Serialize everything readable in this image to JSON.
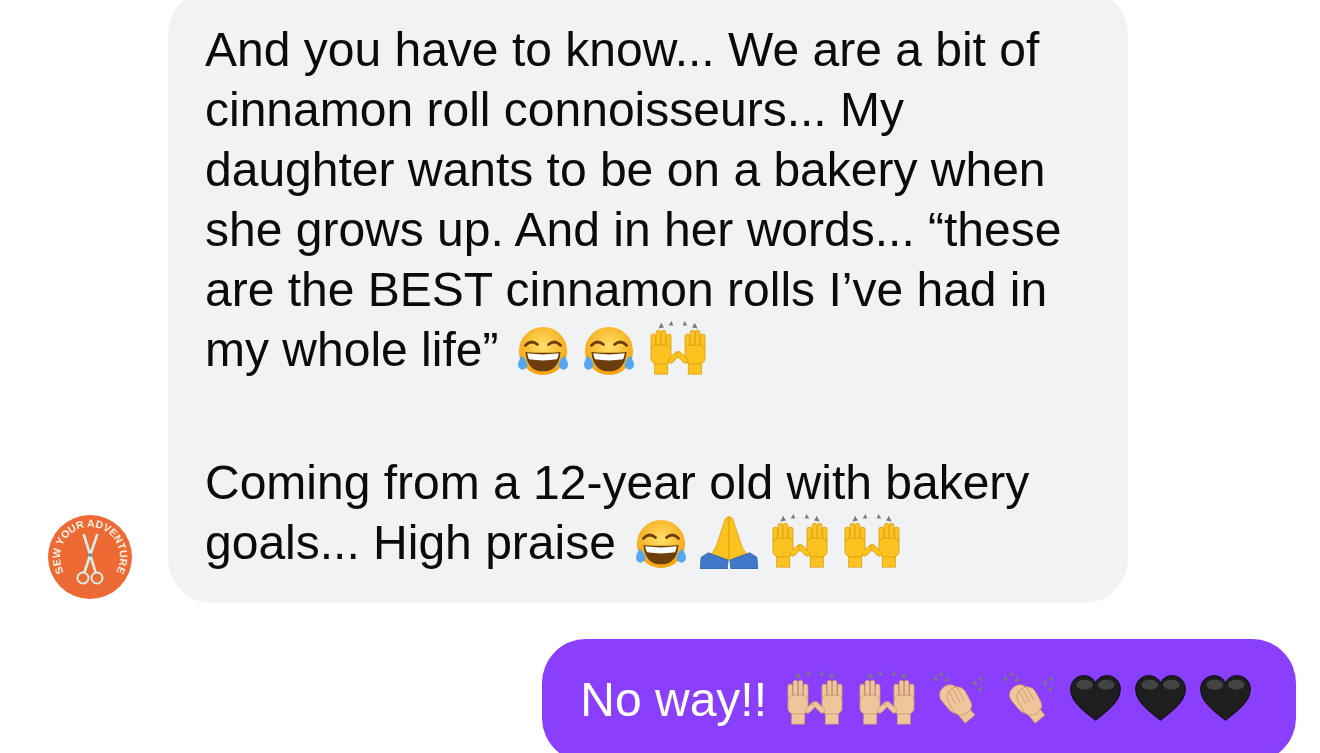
{
  "conversation": {
    "messages": [
      {
        "kind": "received",
        "avatar": {
          "text": "SEW YOUR ADVENTURE"
        },
        "paragraphs": [
          {
            "lines": [
              "And you have to know... We are a bit of",
              "cinnamon roll connoisseurs... My",
              "daughter wants to be on a bakery when",
              "she grows up. And in her words... “these",
              "are the BEST cinnamon rolls I’ve had in",
              "my whole life”"
            ],
            "emojis": [
              {
                "kind": "laugh"
              },
              {
                "kind": "laugh"
              },
              {
                "kind": "raise",
                "light_skin": false
              }
            ]
          },
          {
            "lines": [
              "Coming from a 12-year old with bakery",
              "goals... High praise"
            ],
            "emojis": [
              {
                "kind": "laugh"
              },
              {
                "kind": "pray",
                "light_skin": false
              },
              {
                "kind": "raise",
                "light_skin": false
              },
              {
                "kind": "raise",
                "light_skin": false
              }
            ]
          }
        ]
      },
      {
        "kind": "sent",
        "paragraphs": [
          {
            "lines": [
              "No way!!"
            ],
            "emojis": [
              {
                "kind": "raise",
                "light_skin": true
              },
              {
                "kind": "raise",
                "light_skin": true
              },
              {
                "kind": "clap",
                "light_skin": true
              },
              {
                "kind": "clap",
                "light_skin": true
              },
              {
                "kind": "heart"
              },
              {
                "kind": "heart"
              },
              {
                "kind": "heart"
              }
            ]
          }
        ]
      }
    ]
  }
}
